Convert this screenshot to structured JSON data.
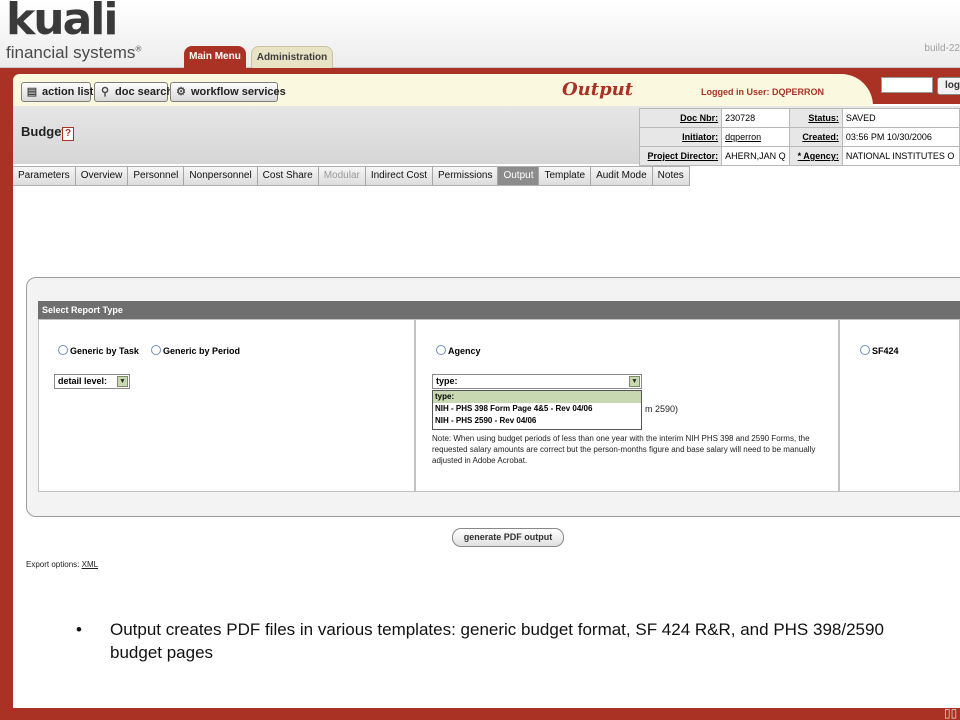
{
  "brand": {
    "logo_word": "kuali",
    "logo_sub": "financial systems",
    "build": "build-22"
  },
  "main_tabs": [
    "Main Menu",
    "Administration"
  ],
  "toolbar": {
    "action_list": "action list",
    "doc_search": "doc search",
    "workflow_services": "workflow services",
    "page_heading": "Output",
    "logged_in": "Logged in User: DQPERRON",
    "login_button": "logi"
  },
  "document": {
    "title": "Budget",
    "doc_nbr_label": "Doc Nbr:",
    "doc_nbr": "230728",
    "status_label": "Status:",
    "status": "SAVED",
    "initiator_label": "Initiator:",
    "initiator": "dqperron",
    "created_label": "Created:",
    "created": "03:56 PM 10/30/2006",
    "project_director_label": "Project Director:",
    "project_director": "AHERN,JAN Q",
    "agency_label": "* Agency:",
    "agency": "NATIONAL INSTITUTES O"
  },
  "subtabs": [
    {
      "label": "Parameters"
    },
    {
      "label": "Overview"
    },
    {
      "label": "Personnel"
    },
    {
      "label": "Nonpersonnel"
    },
    {
      "label": "Cost Share"
    },
    {
      "label": "Modular"
    },
    {
      "label": "Indirect Cost"
    },
    {
      "label": "Permissions"
    },
    {
      "label": "Output"
    },
    {
      "label": "Template"
    },
    {
      "label": "Audit Mode"
    },
    {
      "label": "Notes"
    }
  ],
  "report": {
    "panel_title": "Select Report Type",
    "generic_by_task": "Generic by Task",
    "generic_by_period": "Generic by Period",
    "detail_level": "detail level:",
    "agency": "Agency",
    "type_select": "type:",
    "type_options": [
      "type:",
      "NIH - PHS 398 Form Page 4&5 - Rev 04/06",
      "NIH - PHS 2590 - Rev 04/06"
    ],
    "hidden_form_tail": "m 2590)",
    "note": "Note: When using budget periods of less than one year with the interim NIH PHS 398 and 2590 Forms, the requested salary amounts are correct but the person-months figure and base salary will need to be manually adjusted in Adobe Acrobat.",
    "sf424": "SF424"
  },
  "actions": {
    "generate": "generate PDF output",
    "export_label": "Export options:",
    "export_xml": "XML"
  },
  "caption": {
    "bullet": "•",
    "text": "Output creates PDF files in various templates:  generic budget format, SF 424 R&R, and PHS 398/2590 budget pages"
  },
  "colors": {
    "brand_red": "#a93224",
    "panel_header": "#6f6f6f",
    "active_subtab": "#8c8c8c"
  }
}
